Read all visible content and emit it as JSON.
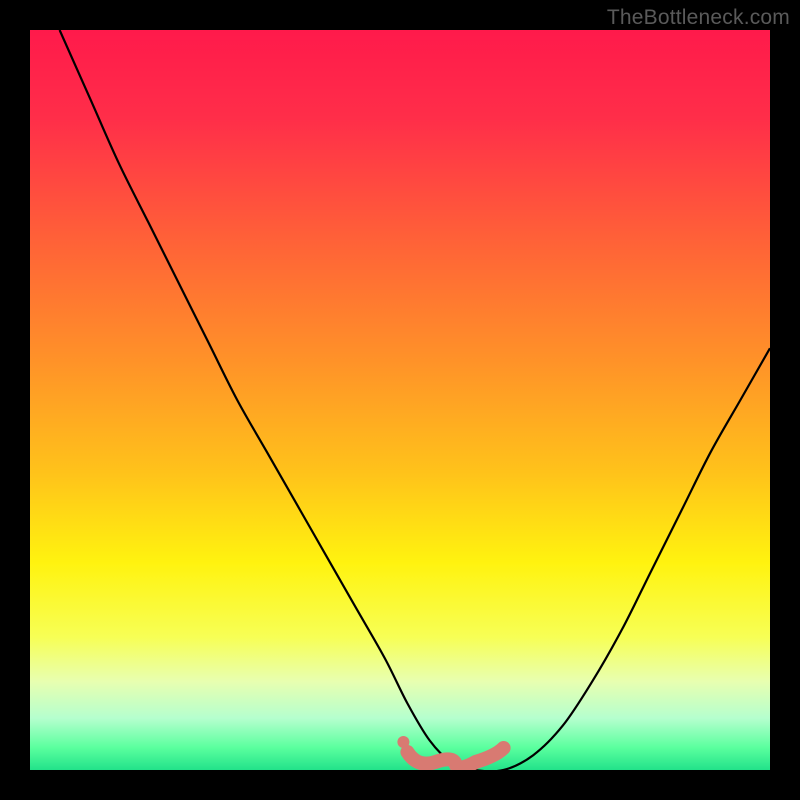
{
  "watermark": {
    "text": "TheBottleneck.com"
  },
  "colors": {
    "gradient_stops": [
      {
        "pct": 0,
        "color": "#ff1a4b"
      },
      {
        "pct": 12,
        "color": "#ff2e49"
      },
      {
        "pct": 28,
        "color": "#ff6038"
      },
      {
        "pct": 45,
        "color": "#ff9328"
      },
      {
        "pct": 60,
        "color": "#ffc31a"
      },
      {
        "pct": 72,
        "color": "#fff30f"
      },
      {
        "pct": 82,
        "color": "#f7ff55"
      },
      {
        "pct": 88,
        "color": "#e8ffb0"
      },
      {
        "pct": 93,
        "color": "#b5ffce"
      },
      {
        "pct": 97,
        "color": "#5aff9e"
      },
      {
        "pct": 100,
        "color": "#22e28a"
      }
    ],
    "curve_stroke": "#000000",
    "valley_marker": "#d87a72",
    "frame_bg": "#000000"
  },
  "chart_data": {
    "type": "line",
    "title": "",
    "xlabel": "",
    "ylabel": "",
    "xlim": [
      0,
      100
    ],
    "ylim": [
      0,
      100
    ],
    "annotations": [],
    "series": [
      {
        "name": "bottleneck-curve",
        "x": [
          4,
          8,
          12,
          16,
          20,
          24,
          28,
          32,
          36,
          40,
          44,
          48,
          51,
          54,
          57,
          60,
          64,
          68,
          72,
          76,
          80,
          84,
          88,
          92,
          96,
          100
        ],
        "values": [
          100,
          91,
          82,
          74,
          66,
          58,
          50,
          43,
          36,
          29,
          22,
          15,
          9,
          4,
          1,
          0,
          0,
          2,
          6,
          12,
          19,
          27,
          35,
          43,
          50,
          57
        ]
      }
    ],
    "valley_marker": {
      "name": "optimal-range",
      "x_start": 51,
      "x_end": 64,
      "y": 0
    }
  }
}
